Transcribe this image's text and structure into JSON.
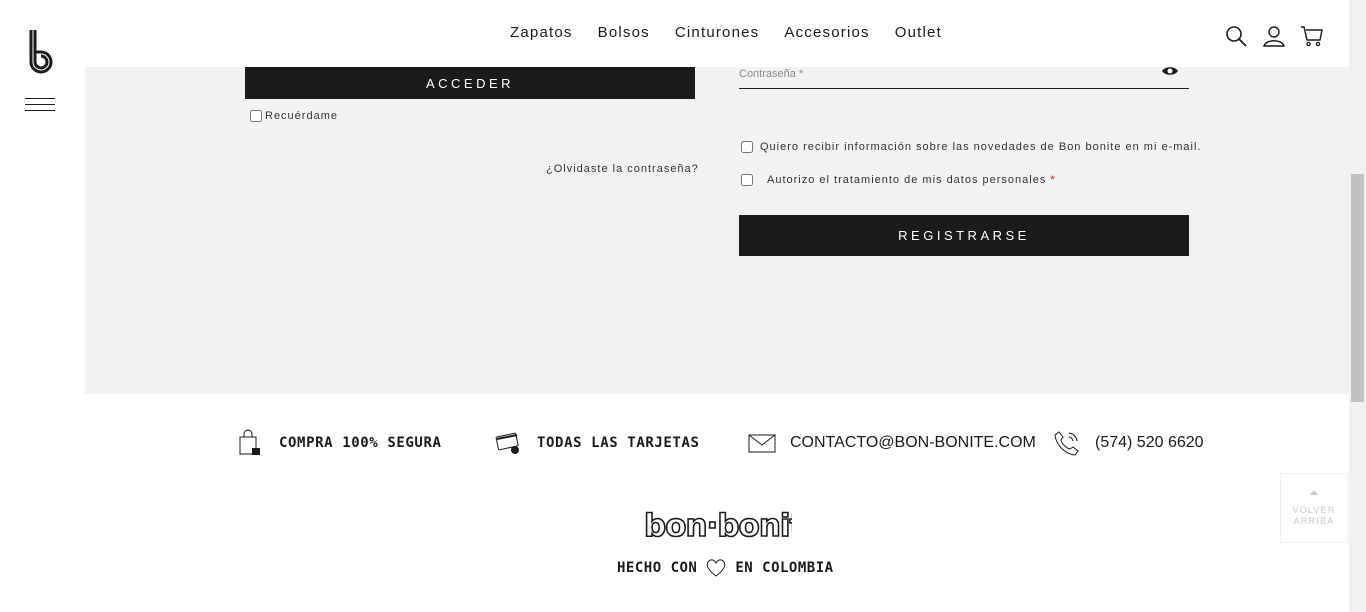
{
  "header": {
    "nav": [
      "Zapatos",
      "Bolsos",
      "Cinturones",
      "Accesorios",
      "Outlet"
    ],
    "icons": [
      "search-icon",
      "user-icon",
      "cart-icon"
    ]
  },
  "login": {
    "submit_label": "ACCEDER",
    "remember_label": "Recuérdame",
    "forgot_label": "¿Olvidaste la contraseña?"
  },
  "register": {
    "password_placeholder": "Contraseña *",
    "newsletter_label": "Quiero recibir información sobre las novedades de Bon bonite en mi e-mail.",
    "privacy_label": "Autorizo el tratamiento de mis datos personales",
    "required_mark": "*",
    "submit_label": "REGISTRARSE"
  },
  "features": [
    {
      "icon": "secure-bag-icon",
      "label": "COMPRA 100% SEGURA"
    },
    {
      "icon": "credit-card-icon",
      "label": "TODAS LAS TARJETAS"
    },
    {
      "icon": "envelope-icon",
      "label": "CONTACTO@BON-BONITE.COM"
    },
    {
      "icon": "phone-icon",
      "label": "(574) 520 6620"
    }
  ],
  "footer": {
    "logo_text": "bon·bonite",
    "made_with_before": "HECHO CON",
    "made_with_after": "EN COLOMBIA"
  },
  "back_to_top": {
    "label": "VOLVER ARRIBA"
  },
  "colors": {
    "dark": "#1b1b1b",
    "content_bg": "#f2f2f2",
    "whatsapp": "#0d6652",
    "required": "#d0021b"
  }
}
